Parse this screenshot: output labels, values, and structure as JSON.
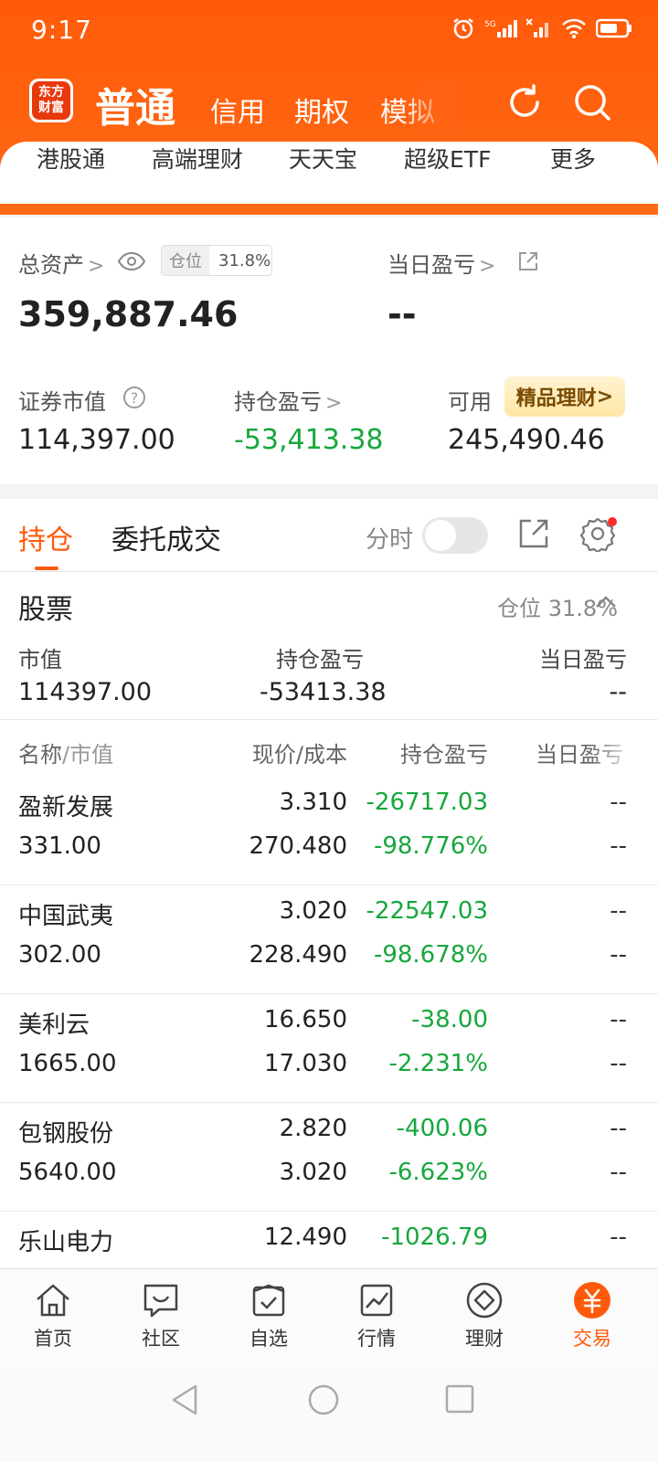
{
  "status": {
    "time": "9:17"
  },
  "nav": {
    "logo_line1": "东方",
    "logo_line2": "财富",
    "tabs": [
      {
        "label": "普通"
      },
      {
        "label": "信用"
      },
      {
        "label": "期权"
      },
      {
        "label": "模拟"
      }
    ]
  },
  "quick_links": [
    {
      "label": "港股通"
    },
    {
      "label": "高端理财"
    },
    {
      "label": "天天宝"
    },
    {
      "label": "超级ETF"
    },
    {
      "label": "更多"
    }
  ],
  "assets": {
    "total_label": "总资产",
    "total_value": "359,887.46",
    "position_tag_label": "仓位",
    "position_tag_value": "31.8%",
    "daily_pl_label": "当日盈亏",
    "daily_pl_value": "--",
    "market_value_label": "证券市值",
    "market_value": "114,397.00",
    "holding_pl_label": "持仓盈亏",
    "holding_pl_value": "-53,413.38",
    "available_label": "可用",
    "available_value": "245,490.46",
    "premium_label": "精品理财"
  },
  "holdings": {
    "tabs": [
      {
        "label": "持仓"
      },
      {
        "label": "委托成交"
      }
    ],
    "fenshi_label": "分时",
    "section_title": "股票",
    "section_position": "仓位 31.8%",
    "summary": {
      "mv_label": "市值",
      "mv_value": "114397.00",
      "pl_label": "持仓盈亏",
      "pl_value": "-53413.38",
      "day_label": "当日盈亏",
      "day_value": "--"
    },
    "columns": {
      "name": "名称",
      "name_sub": "/市值",
      "price": "现价/成本",
      "pl": "持仓盈亏",
      "day": "当日盈亏"
    },
    "rows": [
      {
        "name": "盈新发展",
        "mv": "331.00",
        "price": "3.310",
        "cost": "270.480",
        "pl": "-26717.03",
        "pl_pct": "-98.776%",
        "day1": "--",
        "day2": "--"
      },
      {
        "name": "中国武夷",
        "mv": "302.00",
        "price": "3.020",
        "cost": "228.490",
        "pl": "-22547.03",
        "pl_pct": "-98.678%",
        "day1": "--",
        "day2": "--"
      },
      {
        "name": "美利云",
        "mv": "1665.00",
        "price": "16.650",
        "cost": "17.030",
        "pl": "-38.00",
        "pl_pct": "-2.231%",
        "day1": "--",
        "day2": "--"
      },
      {
        "name": "包钢股份",
        "mv": "5640.00",
        "price": "2.820",
        "cost": "3.020",
        "pl": "-400.06",
        "pl_pct": "-6.623%",
        "day1": "--",
        "day2": "--"
      },
      {
        "name": "乐山电力",
        "mv": "",
        "price": "12.490",
        "cost": "",
        "pl": "-1026.79",
        "pl_pct": "",
        "day1": "--",
        "day2": ""
      }
    ]
  },
  "bottom_nav": [
    {
      "label": "首页"
    },
    {
      "label": "社区"
    },
    {
      "label": "自选"
    },
    {
      "label": "行情"
    },
    {
      "label": "理财"
    },
    {
      "label": "交易"
    }
  ],
  "colors": {
    "brand": "#ff5a0a",
    "loss": "#16a73c"
  }
}
